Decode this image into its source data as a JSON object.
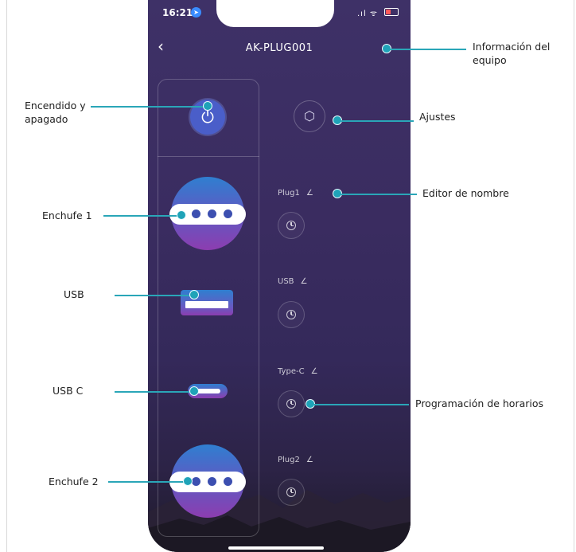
{
  "status_bar": {
    "time": "16:21",
    "signal_wifi": ".ıl ᯤ"
  },
  "header": {
    "title": "AK-PLUG001"
  },
  "panel": {
    "power_symbol": "⏻"
  },
  "right_column": {
    "settings_symbol": "⬡",
    "ports": [
      {
        "label": "Plug1"
      },
      {
        "label": "USB"
      },
      {
        "label": "Type-C"
      },
      {
        "label": "Plug2"
      }
    ],
    "edit_symbol": "∠"
  },
  "callouts": {
    "device_info": "Información del equipo",
    "power": "Encendido y apagado",
    "settings": "Ajustes",
    "name_editor": "Editor de nombre",
    "plug1": "Enchufe 1",
    "usb": "USB",
    "usb_c": "USB C",
    "schedule": "Programación de horarios",
    "plug2": "Enchufe 2"
  },
  "colors": {
    "accent": "#1fa3b8",
    "background": "#3a2c60",
    "power_button": "#4a5ec9"
  }
}
